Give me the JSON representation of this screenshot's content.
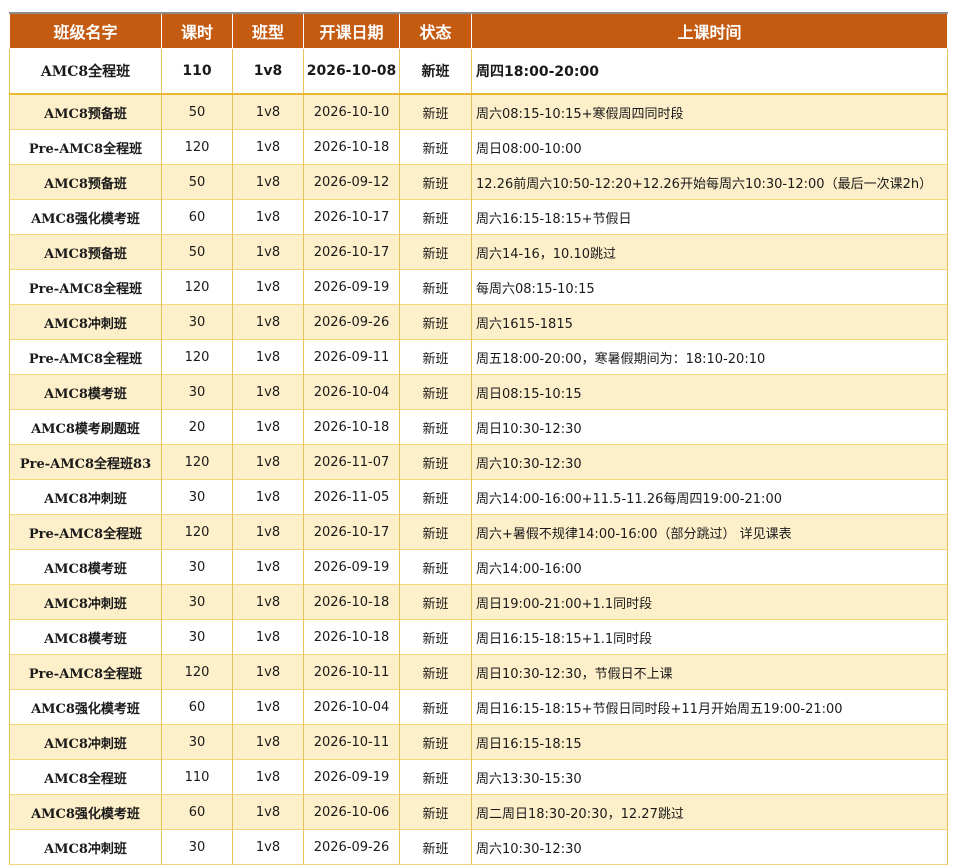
{
  "header": [
    "班级名字",
    "课时",
    "班型",
    "开课日期",
    "状态",
    "上课时间"
  ],
  "rows": [
    {
      "name": "AMC8全程班",
      "hours": "110",
      "type": "1v8",
      "date": "2026-10-08",
      "status": "新班",
      "time": "周四18:00-20:00"
    },
    {
      "name": "AMC8预备班",
      "hours": "50",
      "type": "1v8",
      "date": "2026-10-10",
      "status": "新班",
      "time": "周六08:15-10:15+寒假周四同时段"
    },
    {
      "name": "Pre-AMC8全程班",
      "hours": "120",
      "type": "1v8",
      "date": "2026-10-18",
      "status": "新班",
      "time": "周日08:00-10:00"
    },
    {
      "name": "AMC8预备班",
      "hours": "50",
      "type": "1v8",
      "date": "2026-09-12",
      "status": "新班",
      "time": "12.26前周六10:50-12:20+12.26开始每周六10:30-12:00（最后一次课2h）"
    },
    {
      "name": "AMC8强化模考班",
      "hours": "60",
      "type": "1v8",
      "date": "2026-10-17",
      "status": "新班",
      "time": "周六16:15-18:15+节假日"
    },
    {
      "name": "AMC8预备班",
      "hours": "50",
      "type": "1v8",
      "date": "2026-10-17",
      "status": "新班",
      "time": "周六14-16，10.10跳过"
    },
    {
      "name": "Pre-AMC8全程班",
      "hours": "120",
      "type": "1v8",
      "date": "2026-09-19",
      "status": "新班",
      "time": "每周六08:15-10:15"
    },
    {
      "name": "AMC8冲刺班",
      "hours": "30",
      "type": "1v8",
      "date": "2026-09-26",
      "status": "新班",
      "time": "周六1615-1815"
    },
    {
      "name": "Pre-AMC8全程班",
      "hours": "120",
      "type": "1v8",
      "date": "2026-09-11",
      "status": "新班",
      "time": "周五18:00-20:00，寒暑假期间为：18:10-20:10"
    },
    {
      "name": "AMC8模考班",
      "hours": "30",
      "type": "1v8",
      "date": "2026-10-04",
      "status": "新班",
      "time": "周日08:15-10:15"
    },
    {
      "name": "AMC8模考刷题班",
      "hours": "20",
      "type": "1v8",
      "date": "2026-10-18",
      "status": "新班",
      "time": "周日10:30-12:30"
    },
    {
      "name": "Pre-AMC8全程班83",
      "hours": "120",
      "type": "1v8",
      "date": "2026-11-07",
      "status": "新班",
      "time": "周六10:30-12:30"
    },
    {
      "name": "AMC8冲刺班",
      "hours": "30",
      "type": "1v8",
      "date": "2026-11-05",
      "status": "新班",
      "time": "周六14:00-16:00+11.5-11.26每周四19:00-21:00"
    },
    {
      "name": "Pre-AMC8全程班",
      "hours": "120",
      "type": "1v8",
      "date": "2026-10-17",
      "status": "新班",
      "time": "周六+暑假不规律14:00-16:00（部分跳过） 详见课表"
    },
    {
      "name": "AMC8模考班",
      "hours": "30",
      "type": "1v8",
      "date": "2026-09-19",
      "status": "新班",
      "time": "周六14:00-16:00"
    },
    {
      "name": "AMC8冲刺班",
      "hours": "30",
      "type": "1v8",
      "date": "2026-10-18",
      "status": "新班",
      "time": "周日19:00-21:00+1.1同时段"
    },
    {
      "name": "AMC8模考班",
      "hours": "30",
      "type": "1v8",
      "date": "2026-10-18",
      "status": "新班",
      "time": "周日16:15-18:15+1.1同时段"
    },
    {
      "name": "Pre-AMC8全程班",
      "hours": "120",
      "type": "1v8",
      "date": "2026-10-11",
      "status": "新班",
      "time": "周日10:30-12:30，节假日不上课"
    },
    {
      "name": "AMC8强化模考班",
      "hours": "60",
      "type": "1v8",
      "date": "2026-10-04",
      "status": "新班",
      "time": "周日16:15-18:15+节假日同时段+11月开始周五19:00-21:00"
    },
    {
      "name": "AMC8冲刺班",
      "hours": "30",
      "type": "1v8",
      "date": "2026-10-11",
      "status": "新班",
      "time": "周日16:15-18:15"
    },
    {
      "name": "AMC8全程班",
      "hours": "110",
      "type": "1v8",
      "date": "2026-09-19",
      "status": "新班",
      "time": "周六13:30-15:30"
    },
    {
      "name": "AMC8强化模考班",
      "hours": "60",
      "type": "1v8",
      "date": "2026-10-06",
      "status": "新班",
      "time": "周二周日18:30-20:30，12.27跳过"
    },
    {
      "name": "AMC8冲刺班",
      "hours": "30",
      "type": "1v8",
      "date": "2026-09-26",
      "status": "新班",
      "time": "周六10:30-12:30"
    }
  ]
}
